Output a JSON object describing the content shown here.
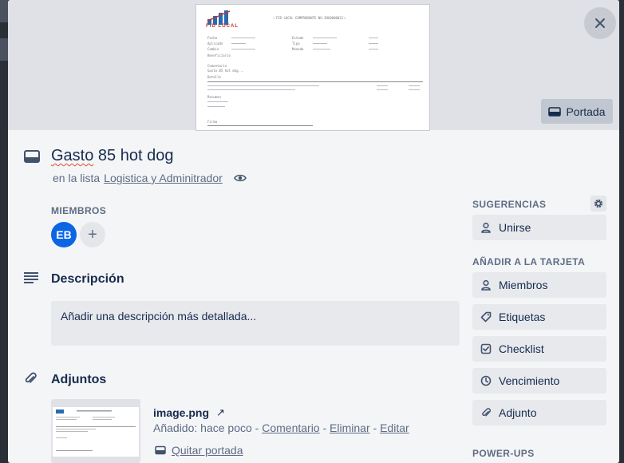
{
  "cover": {
    "button_label": "Portada"
  },
  "card": {
    "title_word": "Gasto",
    "title_rest": " 85 hot dog",
    "list_prefix": "en la lista",
    "list_name": "Logistica y Adminitrador"
  },
  "members": {
    "label": "MIEMBROS",
    "avatar_initials": "EB",
    "add_symbol": "+"
  },
  "description": {
    "title": "Descripción",
    "placeholder": "Añadir una descripción más detallada..."
  },
  "attachments": {
    "title": "Adjuntos",
    "file_name": "image.png",
    "open_symbol": "↗",
    "added_text": "Añadido: hace poco",
    "separator": " - ",
    "comment_link": "Comentario",
    "delete_link": "Eliminar",
    "edit_link": "Editar",
    "remove_cover_label": "Quitar portada"
  },
  "sidebar": {
    "suggestions_label": "SUGERENCIAS",
    "join_label": "Unirse",
    "add_to_card_label": "AÑADIR A LA TARJETA",
    "items": [
      {
        "label": "Miembros",
        "icon": "person-icon"
      },
      {
        "label": "Etiquetas",
        "icon": "tag-icon"
      },
      {
        "label": "Checklist",
        "icon": "checkbox-icon"
      },
      {
        "label": "Vencimiento",
        "icon": "clock-icon"
      },
      {
        "label": "Adjunto",
        "icon": "paperclip-icon"
      }
    ],
    "powerups_label": "POWER-UPS"
  },
  "cover_document": {
    "header": "::FID LOCAL COMPROBANTE NO.JNG0000022::",
    "brand": "FID LOCAL",
    "fields_left": [
      "Fecha",
      "Aplicado",
      "Cambio",
      "Beneficiario"
    ],
    "fields_right": [
      "Estado",
      "Tipo",
      "Moneda"
    ],
    "comment_label": "Comentario",
    "comment_text": "Gasto 85 hot dog...",
    "detail_label": "Detalle",
    "summary_label": "Resumen",
    "signature_label": "Firma"
  },
  "colors": {
    "modal_bg": "#f4f5f7",
    "button_bg": "#e7e9ed",
    "avatar_bg": "#0c66e4",
    "text_primary": "#172b4d",
    "text_secondary": "#5e6c84"
  }
}
